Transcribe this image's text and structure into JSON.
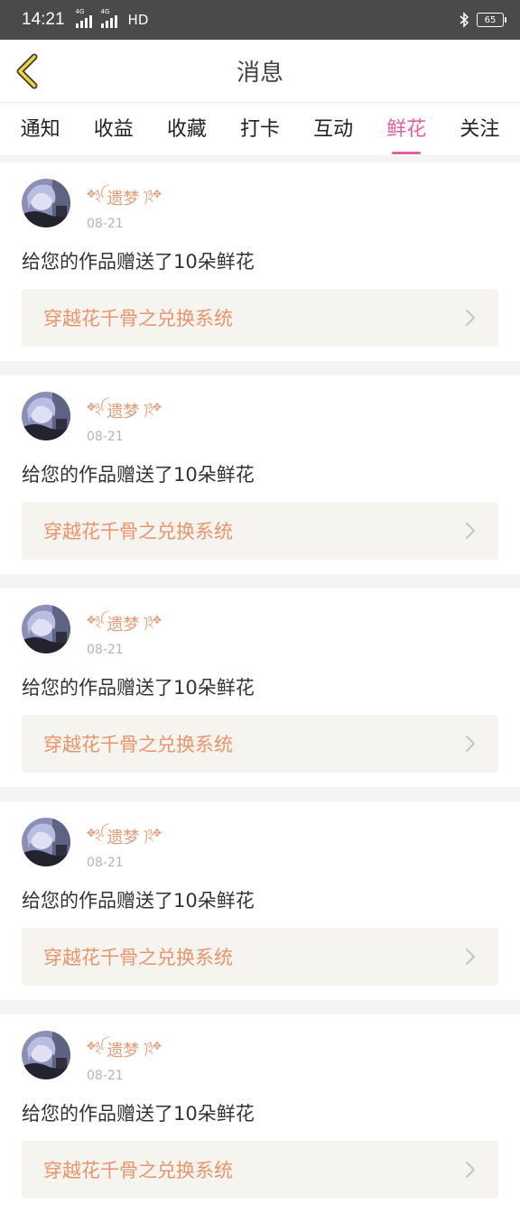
{
  "status": {
    "time": "14:21",
    "net1": "4G",
    "net2": "4G",
    "hd": "HD",
    "battery": "65"
  },
  "header": {
    "title": "消息"
  },
  "tabs": [
    {
      "label": "通知"
    },
    {
      "label": "收益"
    },
    {
      "label": "收藏"
    },
    {
      "label": "打卡"
    },
    {
      "label": "互动"
    },
    {
      "label": "鲜花",
      "active": true
    },
    {
      "label": "关注"
    }
  ],
  "colors": {
    "accent": "#e2609e",
    "name": "#e39a73",
    "work_text": "#e8946a",
    "work_bg": "#f6f4ef"
  },
  "messages": [
    {
      "user": "遗梦",
      "orn_left": "✥྅ꪶ",
      "orn_right": "ꫂ྅✥",
      "date": "08-21",
      "text": "给您的作品赠送了10朵鲜花",
      "work": "穿越花千骨之兑换系统"
    },
    {
      "user": "遗梦",
      "orn_left": "✥྅ꪶ",
      "orn_right": "ꫂ྅✥",
      "date": "08-21",
      "text": "给您的作品赠送了10朵鲜花",
      "work": "穿越花千骨之兑换系统"
    },
    {
      "user": "遗梦",
      "orn_left": "✥྅ꪶ",
      "orn_right": "ꫂ྅✥",
      "date": "08-21",
      "text": "给您的作品赠送了10朵鲜花",
      "work": "穿越花千骨之兑换系统"
    },
    {
      "user": "遗梦",
      "orn_left": "✥྅ꪶ",
      "orn_right": "ꫂ྅✥",
      "date": "08-21",
      "text": "给您的作品赠送了10朵鲜花",
      "work": "穿越花千骨之兑换系统"
    },
    {
      "user": "遗梦",
      "orn_left": "✥྅ꪶ",
      "orn_right": "ꫂ྅✥",
      "date": "08-21",
      "text": "给您的作品赠送了10朵鲜花",
      "work": "穿越花千骨之兑换系统"
    }
  ]
}
